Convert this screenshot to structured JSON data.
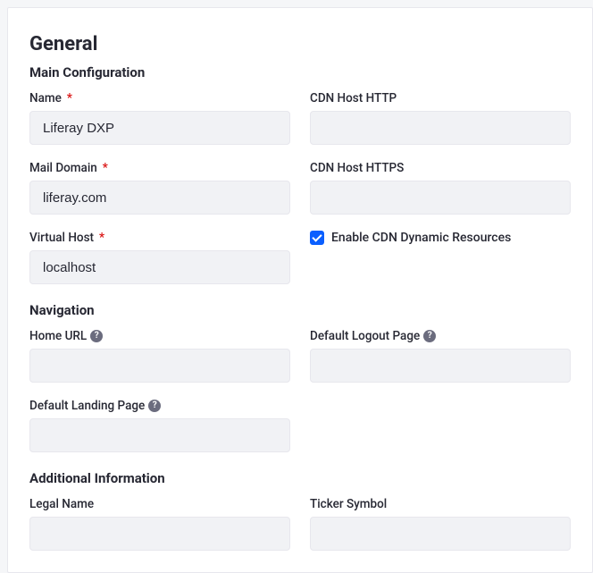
{
  "section": {
    "title": "General",
    "main_config": {
      "title": "Main Configuration",
      "name_label": "Name",
      "name_value": "Liferay DXP",
      "mail_domain_label": "Mail Domain",
      "mail_domain_value": "liferay.com",
      "virtual_host_label": "Virtual Host",
      "virtual_host_value": "localhost",
      "cdn_http_label": "CDN Host HTTP",
      "cdn_http_value": "",
      "cdn_https_label": "CDN Host HTTPS",
      "cdn_https_value": "",
      "enable_cdn_label": "Enable CDN Dynamic Resources"
    },
    "navigation": {
      "title": "Navigation",
      "home_url_label": "Home URL",
      "home_url_value": "",
      "default_landing_label": "Default Landing Page",
      "default_landing_value": "",
      "default_logout_label": "Default Logout Page",
      "default_logout_value": ""
    },
    "additional": {
      "title": "Additional Information",
      "legal_name_label": "Legal Name",
      "legal_name_value": "",
      "ticker_label": "Ticker Symbol",
      "ticker_value": ""
    }
  },
  "glyphs": {
    "required": "*",
    "help": "?"
  }
}
